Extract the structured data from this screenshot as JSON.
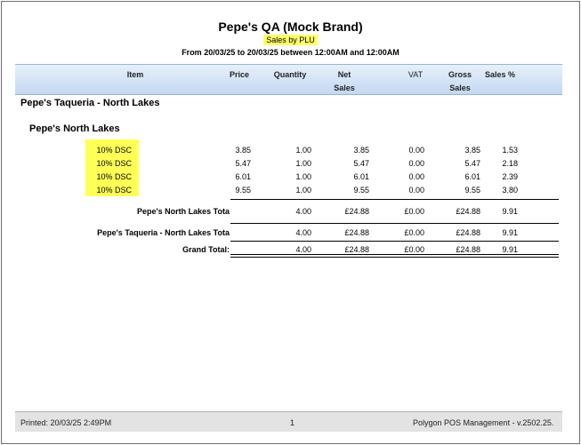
{
  "report": {
    "title": "Pepe's QA (Mock Brand)",
    "subtitle": "Sales by PLU",
    "range": "From 20/03/25 to 20/03/25 between 12:00AM and 12:00AM"
  },
  "columns": {
    "item": "Item",
    "price": "Price",
    "quantity": "Quantity",
    "net_1": "Net",
    "net_2": "Sales",
    "vat": "VAT",
    "gross_1": "Gross",
    "gross_2": "Sales",
    "sales_pct": "Sales %"
  },
  "group": "Pepe's Taqueria - North Lakes",
  "subgroup": "Pepe's North Lakes",
  "rows": [
    {
      "item": "10% DSC",
      "price": "3.85",
      "quantity": "1.00",
      "net": "3.85",
      "vat": "0.00",
      "gross": "3.85",
      "pct": "1.53"
    },
    {
      "item": "10% DSC",
      "price": "5.47",
      "quantity": "1.00",
      "net": "5.47",
      "vat": "0.00",
      "gross": "5.47",
      "pct": "2.18"
    },
    {
      "item": "10% DSC",
      "price": "6.01",
      "quantity": "1.00",
      "net": "6.01",
      "vat": "0.00",
      "gross": "6.01",
      "pct": "2.39"
    },
    {
      "item": "10% DSC",
      "price": "9.55",
      "quantity": "1.00",
      "net": "9.55",
      "vat": "0.00",
      "gross": "9.55",
      "pct": "3.80"
    }
  ],
  "totals": [
    {
      "label": "Pepe's North Lakes Tota",
      "quantity": "4.00",
      "net": "£24.88",
      "vat": "£0.00",
      "gross": "£24.88",
      "pct": "9.91"
    },
    {
      "label": "Pepe's Taqueria - North Lakes Tota",
      "quantity": "4.00",
      "net": "£24.88",
      "vat": "£0.00",
      "gross": "£24.88",
      "pct": "9.91"
    },
    {
      "label": "Grand Total:",
      "quantity": "4.00",
      "net": "£24.88",
      "vat": "£0.00",
      "gross": "£24.88",
      "pct": "9.91"
    }
  ],
  "footer": {
    "printed": "Printed: 20/03/25  2:49PM",
    "page": "1",
    "app": "Polygon POS Management - v.2502.25."
  }
}
